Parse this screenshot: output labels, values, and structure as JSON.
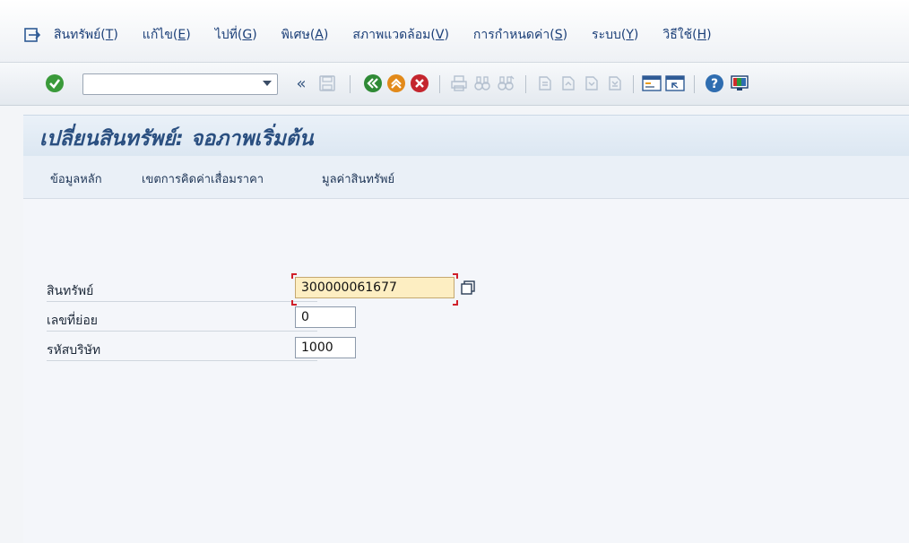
{
  "menu": {
    "items": [
      {
        "name": "menu-asset",
        "text": "สินทรัพย์",
        "key": "T"
      },
      {
        "name": "menu-edit",
        "text": "แก้ไข",
        "key": "E"
      },
      {
        "name": "menu-goto",
        "text": "ไปที่",
        "key": "G"
      },
      {
        "name": "menu-extras",
        "text": "พิเศษ",
        "key": "A"
      },
      {
        "name": "menu-environment",
        "text": "สภาพแวดล้อม",
        "key": "V"
      },
      {
        "name": "menu-settings",
        "text": "การกำหนดค่า",
        "key": "S"
      },
      {
        "name": "menu-system",
        "text": "ระบบ",
        "key": "Y"
      },
      {
        "name": "menu-help",
        "text": "วิธีใช้",
        "key": "H"
      }
    ]
  },
  "toolbar": {
    "command_field_value": "",
    "back_chevrons": "«",
    "colors": {
      "enter": "#3a9a3a",
      "back": "#2f8a36",
      "exit": "#e28a1a",
      "cancel": "#c4262e"
    }
  },
  "screen": {
    "title": "เปลี่ยนสินทรัพย์: จอภาพเริ่มต้น"
  },
  "app_toolbar": {
    "buttons": [
      "ข้อมูลหลัก",
      "เขตการคิดค่าเสื่อมราคา",
      "มูลค่าสินทรัพย์"
    ]
  },
  "form": {
    "asset": {
      "label": "สินทรัพย์",
      "value": "300000061677"
    },
    "subnumber": {
      "label": "เลขที่ย่อย",
      "value": "0"
    },
    "company_code": {
      "label": "รหัสบริษัท",
      "value": "1000"
    }
  }
}
